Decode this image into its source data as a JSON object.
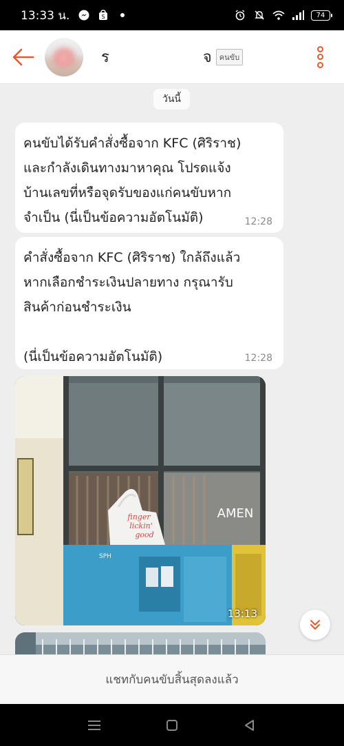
{
  "status_bar": {
    "time": "13:33 น.",
    "battery": "74",
    "icons": [
      "messenger-icon",
      "shopping-icon",
      "dot-icon",
      "alarm-icon",
      "mute-icon",
      "wifi-icon",
      "signal-icon",
      "battery-icon"
    ]
  },
  "header": {
    "driver_name": "ร",
    "driver_sub": "จ",
    "role_tag": "คนขับ",
    "accent_color": "#e8582b"
  },
  "chat": {
    "date_label": "วันนี้",
    "messages": [
      {
        "text": "คนขับได้รับคำสั่งซื้อจาก KFC (ศิริราช)\nและกำลังเดินทางมาหาคุณ โปรดแจ้ง\nบ้านเลขที่หรือจุดรับของแก่คนขับหาก\nจำเป็น (นี่เป็นข้อความอัตโนมัติ)",
        "time": "12:28"
      },
      {
        "text": "คำสั่งซื้อจาก KFC (ศิริราช) ใกล้ถึงแล้ว\nหากเลือกชำระเงินปลายทาง กรุณารับ\nสินค้าก่อนชำระเงิน\n\n(นี่เป็นข้อความอัตโนมัติ)",
        "time": "12:28"
      }
    ],
    "photo": {
      "time": "13:13",
      "bag_text": [
        "finger",
        "lickin'",
        "good"
      ],
      "shelf_brand": "SPH",
      "sign_text": "AMEN"
    }
  },
  "footer": {
    "ended_text": "แชทกับคนขับสิ้นสุดลงแล้ว"
  }
}
